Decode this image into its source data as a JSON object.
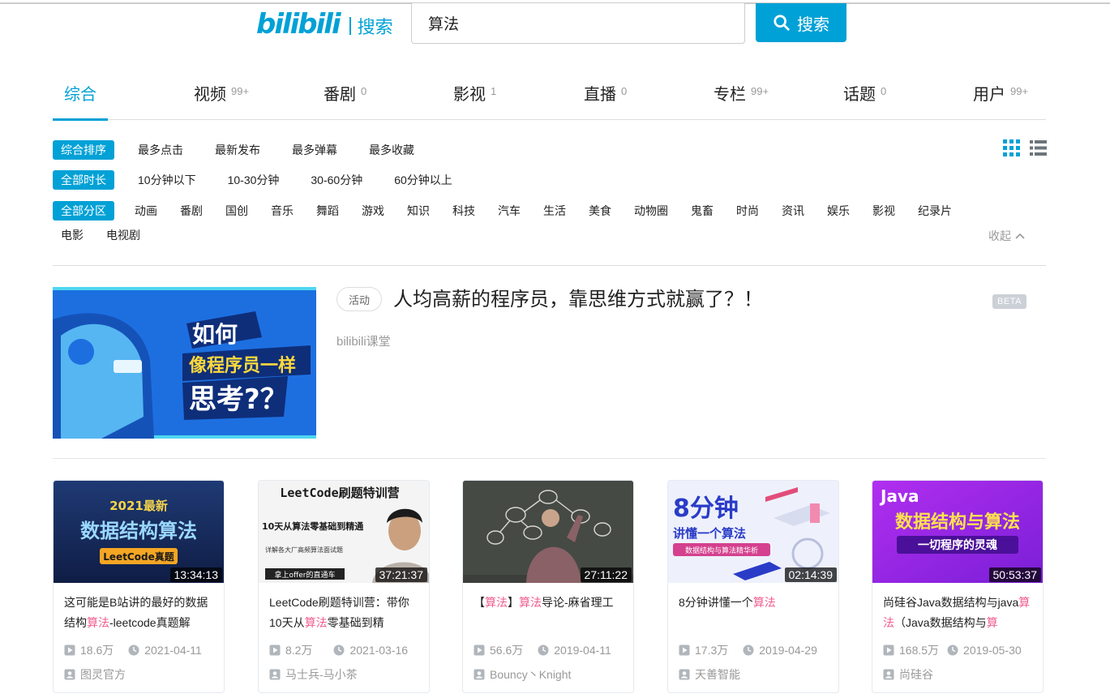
{
  "header": {
    "logo_text": "bilibili",
    "logo_sub": "搜索",
    "search_value": "算法",
    "search_button": "搜索"
  },
  "tabs": [
    {
      "label": "综合",
      "count": ""
    },
    {
      "label": "视频",
      "count": "99+"
    },
    {
      "label": "番剧",
      "count": "0"
    },
    {
      "label": "影视",
      "count": "1"
    },
    {
      "label": "直播",
      "count": "0"
    },
    {
      "label": "专栏",
      "count": "99+"
    },
    {
      "label": "话题",
      "count": "0"
    },
    {
      "label": "用户",
      "count": "99+"
    }
  ],
  "filters": {
    "order": {
      "active": "综合排序",
      "items": [
        "最多点击",
        "最新发布",
        "最多弹幕",
        "最多收藏"
      ]
    },
    "duration": {
      "active": "全部时长",
      "items": [
        "10分钟以下",
        "10-30分钟",
        "30-60分钟",
        "60分钟以上"
      ]
    },
    "zone": {
      "active": "全部分区",
      "items": [
        "动画",
        "番剧",
        "国创",
        "音乐",
        "舞蹈",
        "游戏",
        "知识",
        "科技",
        "汽车",
        "生活",
        "美食",
        "动物圈",
        "鬼畜",
        "时尚",
        "资讯",
        "娱乐",
        "影视",
        "纪录片"
      ],
      "items2": [
        "电影",
        "电视剧"
      ]
    },
    "collapse": "收起"
  },
  "ad": {
    "tag": "活动",
    "title": "人均高薪的程序员，靠思维方式就赢了？！",
    "source": "bilibili课堂",
    "beta": "BETA",
    "image_line1": "如何",
    "image_line2": "像程序员一样",
    "image_line3": "思考?？"
  },
  "videos": [
    {
      "duration": "13:34:13",
      "title_parts": [
        "这可能是B站讲的最好的数据结构",
        "算法",
        "-leetcode真题解"
      ],
      "views": "18.6万",
      "date": "2021-04-11",
      "uploader": "图灵官方",
      "thumb_line1": "2021最新",
      "thumb_line2": "数据结构算法",
      "thumb_line3": "LeetCode真题"
    },
    {
      "duration": "37:21:37",
      "title_parts": [
        "LeetCode刷题特训营：带你10天从",
        "算法",
        "零基础到精"
      ],
      "views": "8.2万",
      "date": "2021-03-16",
      "uploader": "马士兵-马小茶",
      "thumb_line1": "LeetCode刷题特训营",
      "thumb_line2": "10天从算法零基础到精通",
      "thumb_line3": "详解各大厂高频算法面试题",
      "thumb_line4": "拿上offer的直通车"
    },
    {
      "duration": "27:11:22",
      "title_parts": [
        "【",
        "算法",
        "】",
        "算法",
        "导论-麻省理工"
      ],
      "views": "56.6万",
      "date": "2019-04-11",
      "uploader": "Bouncy丶Knight"
    },
    {
      "duration": "02:14:39",
      "title_parts": [
        "8分钟讲懂一个",
        "算法",
        ""
      ],
      "views": "17.3万",
      "date": "2019-04-29",
      "uploader": "天善智能",
      "thumb_line1": "8分钟",
      "thumb_line2": "讲懂一个算法",
      "thumb_line3": "数据结构与算法精华析"
    },
    {
      "duration": "50:53:37",
      "title_parts": [
        "尚硅谷Java数据结构与java",
        "算法",
        "（Java数据结构与",
        "算"
      ],
      "views": "168.5万",
      "date": "2019-05-30",
      "uploader": "尚硅谷",
      "thumb_line1": "Java",
      "thumb_line2": "数据结构与算法",
      "thumb_line3": "一切程序的灵魂"
    }
  ],
  "colors": {
    "accent": "#00a1d6",
    "highlight": "#f25d8e",
    "muted": "#999999"
  }
}
